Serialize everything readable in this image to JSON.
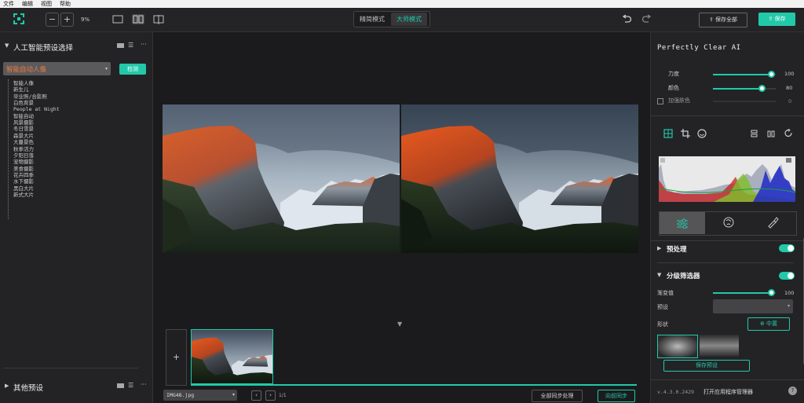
{
  "menu": [
    "文件",
    "编辑",
    "视图",
    "帮助"
  ],
  "toolbar": {
    "minus": "−",
    "plus": "+",
    "zoom": "9%",
    "mode_simple": "精简模式",
    "mode_master": "大师模式",
    "save_all": "保存全部",
    "save": "保存"
  },
  "left": {
    "title": "人工智能预设选择",
    "dropdown_value": "智能自动人像",
    "detect_btn": "检测",
    "presets": [
      "智能人像",
      "新生儿",
      "毕业照/合影照",
      "白色背景",
      "People at Night",
      "智能自动",
      "风景摄影",
      "冬日雪景",
      "森景大片",
      "大蔓景色",
      "秋季活力",
      "夕阳日落",
      "宠物摄影",
      "美食摄影",
      "花卉四季",
      "水下摄影",
      "黑白大片",
      "新式大片"
    ],
    "other_presets": "其他预设"
  },
  "canvas": {
    "collapse_arrow": "▼",
    "add_btn": "+",
    "file_select": "IMG48.jpg",
    "page_info": "1/1",
    "sync_all": "全部同步处理",
    "sync_forward": "向前同步"
  },
  "right": {
    "title": "Perfectly Clear AI",
    "strength_label": "力度",
    "strength_value": "100",
    "strength_level": 0.93,
    "color_label": "颜色",
    "color_value": "80",
    "color_level": 0.77,
    "skin_label": "加强肤色",
    "skin_value": "0",
    "preprocess_label": "预处理",
    "filter_label": "分级筛选器",
    "gradient_label": "渐变值",
    "gradient_value": "100",
    "gradient_level": 0.93,
    "preset_label": "预设",
    "shape_label": "形状",
    "center_btn": "中置",
    "save_preset": "保存预设",
    "version": "v.4.3.0.2429",
    "open_manager": "打开应用程序管理器",
    "help": "?"
  },
  "colors": {
    "accent": "#22c9a8",
    "bg": "#1e1e20"
  }
}
